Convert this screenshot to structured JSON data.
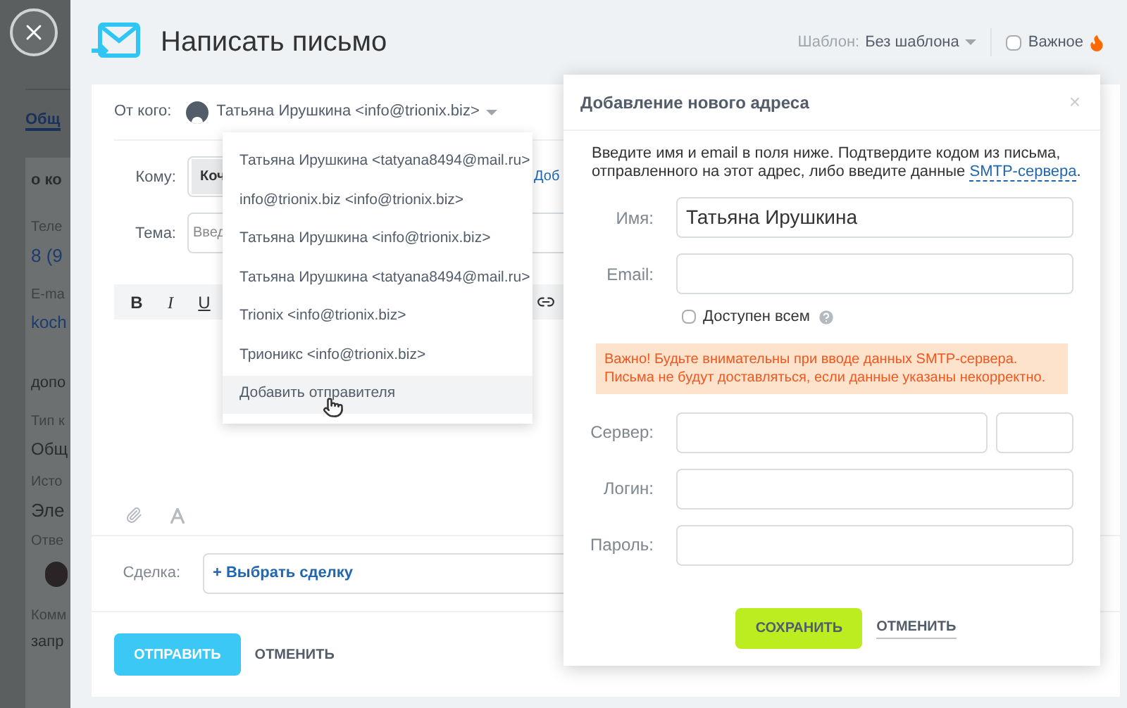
{
  "background_page": {
    "tab": "Общ",
    "section_1": "о ко",
    "phone_label": "Теле",
    "phone": "8 (9",
    "email_label": "E-ma",
    "email": "koch",
    "section_2": "допо",
    "type_label": "Тип к",
    "type_value": "Общ",
    "source_label": "Исто",
    "source_value": "Эле",
    "responsible_label": "Отве",
    "comment_label": "Комм",
    "comment_value": "запр"
  },
  "compose": {
    "title": "Написать письмо",
    "template_label": "Шаблон:",
    "template_value": "Без шаблона",
    "important": {
      "label": "Важное",
      "checked": false
    },
    "from_label": "От кого:",
    "from_value": "Татьяна Ирушкина <info@trionix.biz>",
    "to_label": "Кому:",
    "to_chip": "Коч",
    "to_link": "Доб",
    "subject_label": "Тема:",
    "subject_placeholder": "Введ",
    "toolbar": [
      {
        "kind": "bold",
        "label": "B"
      },
      {
        "kind": "italic",
        "label": "I"
      },
      {
        "kind": "underline",
        "label": "U"
      }
    ],
    "deal_label": "Сделка:",
    "deal_link": "+ Выбрать сделку",
    "send": "ОТПРАВИТЬ",
    "cancel": "ОТМЕНИТЬ"
  },
  "sender_menu": {
    "items": [
      {
        "label": "Татьяна Ирушкина <tatyana8494@mail.ru>",
        "selected": false
      },
      {
        "label": "info@trionix.biz <info@trionix.biz>",
        "selected": false
      },
      {
        "label": "Татьяна Ирушкина <info@trionix.biz>",
        "selected": false
      },
      {
        "label": "Татьяна Ирушкина <tatyana8494@mail.ru>",
        "selected": false
      },
      {
        "label": "Trionix <info@trionix.biz>",
        "selected": false
      },
      {
        "label": "Трионикс <info@trionix.biz>",
        "selected": false
      },
      {
        "label": "Добавить отправителя",
        "selected": true
      }
    ]
  },
  "add_address": {
    "title": "Добавление нового адреса",
    "close": "×",
    "intro": "Введите имя и email в поля ниже. Подтвердите кодом из письма, отправленного на этот адрес, либо введите данные ",
    "intro_link": "SMTP-сервера",
    "intro_end": ".",
    "name_label": "Имя:",
    "name_value": "Татьяна Ирушкина",
    "email_label": "Email:",
    "shared": {
      "label": "Доступен всем",
      "checked": false
    },
    "warning": [
      "Важно! Будьте внимательны при вводе данных SMTP-сервера.",
      "Письма не будут доставляться, если данные указаны некорректно."
    ],
    "server_label": "Сервер:",
    "login_label": "Логин:",
    "password_label": "Пароль:",
    "save": "СОХРАНИТЬ",
    "cancel": "ОТМЕНИТЬ"
  }
}
